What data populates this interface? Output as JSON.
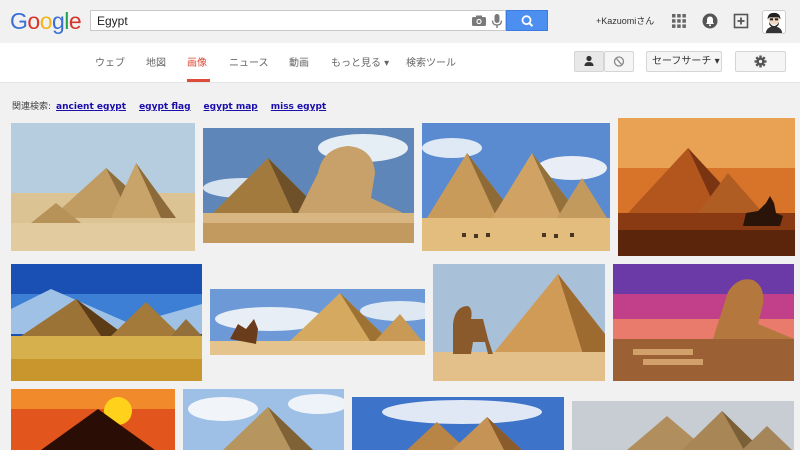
{
  "logo": {
    "letters": [
      {
        "ch": "G",
        "color": "#3a6fd8"
      },
      {
        "ch": "o",
        "color": "#d6372b"
      },
      {
        "ch": "o",
        "color": "#f3b51a"
      },
      {
        "ch": "g",
        "color": "#3a6fd8"
      },
      {
        "ch": "l",
        "color": "#22a04b"
      },
      {
        "ch": "e",
        "color": "#d6372b"
      }
    ]
  },
  "search": {
    "value": "Egypt"
  },
  "header": {
    "user_label": "+Kazuomiさん",
    "icons": [
      "apps-grid-icon",
      "notifications-icon",
      "share-plus-icon",
      "avatar"
    ]
  },
  "nav": {
    "tabs": [
      "ウェブ",
      "地図",
      "画像",
      "ニュース",
      "動画",
      "もっと見る ▾",
      "検索ツール"
    ],
    "active": "画像",
    "safesearch_label": "セーフサーチ ▾"
  },
  "related": {
    "prefix": "関連検索:",
    "links": [
      "ancient egypt",
      "egypt flag",
      "egypt map",
      "miss egypt"
    ]
  },
  "colors": {
    "accent_red": "#dd4b39",
    "search_blue": "#4d8ff0",
    "link_blue": "#1a0dab"
  },
  "results": [
    {
      "subject": "giza pyramids"
    },
    {
      "subject": "sphinx and pyramid"
    },
    {
      "subject": "pyramids with camel caravan"
    },
    {
      "subject": "pyramids at sunset with camel rider"
    },
    {
      "subject": "three pyramids under blue sky"
    },
    {
      "subject": "camel rider before pyramids"
    },
    {
      "subject": "camel before great pyramid"
    },
    {
      "subject": "sphinx at dusk"
    },
    {
      "subject": "pyramid silhouette with sun"
    },
    {
      "subject": "pyramid under clouds"
    },
    {
      "subject": "pyramids and sky"
    },
    {
      "subject": "pyramids in haze"
    }
  ]
}
